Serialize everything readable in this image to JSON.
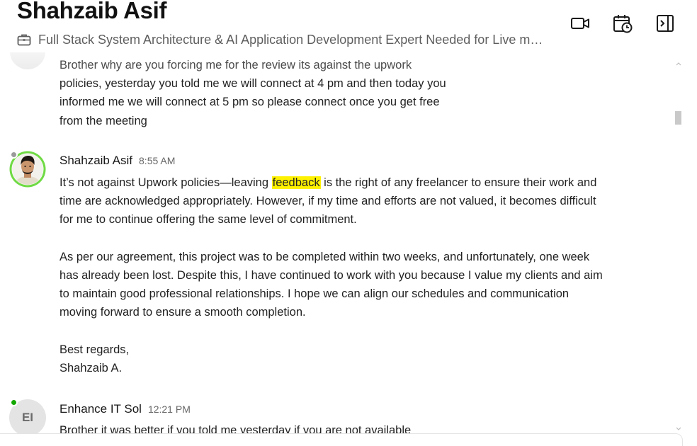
{
  "header": {
    "contact_name": "Shahzaib Asif",
    "job_title": "Full Stack System Architecture & AI Application Development Expert Needed for Live me...",
    "icons": {
      "job": "briefcase-icon",
      "video": "video-camera-icon",
      "schedule": "calendar-clock-icon",
      "panel": "side-panel-icon"
    }
  },
  "messages": {
    "prev": {
      "lines": [
        "Brother why are you forcing me for the review its against the upwork",
        "policies, yesterday you told me we will connect at 4 pm and then today you",
        "informed me we will connect at 5 pm so please connect once you get free",
        "from the meeting"
      ]
    },
    "shahzaib": {
      "name": "Shahzaib Asif",
      "time": "8:55 AM",
      "p1": {
        "line1_before": "It’s not against Upwork policies—leaving ",
        "line1_highlight": "feedback",
        "line1_after": " is the right of any freelancer to ensure their work and",
        "line2": "time are acknowledged appropriately. However, if my time and efforts are not valued, it becomes difficult",
        "line3": "for me to continue offering the same level of commitment."
      },
      "p2": [
        "As per our agreement, this project was to be completed within two weeks, and unfortunately, one week",
        "has already been lost. Despite this, I have continued to work with you because I value my clients and aim",
        "to maintain good professional relationships. I hope we can align our schedules and communication",
        "moving forward to ensure a smooth completion."
      ],
      "p3": [
        "Best regards,",
        "Shahzaib A."
      ],
      "presence_color": "#9a9a9a"
    },
    "enhance": {
      "initials": "EI",
      "name": "Enhance IT Sol",
      "time": "12:21 PM",
      "line1": "Brother it was better if you told me yesterday if you are not available",
      "presence_color": "#14a800"
    }
  },
  "colors": {
    "highlight": "#fff200",
    "online": "#14a800",
    "avatar_ring": "#6fda44"
  }
}
